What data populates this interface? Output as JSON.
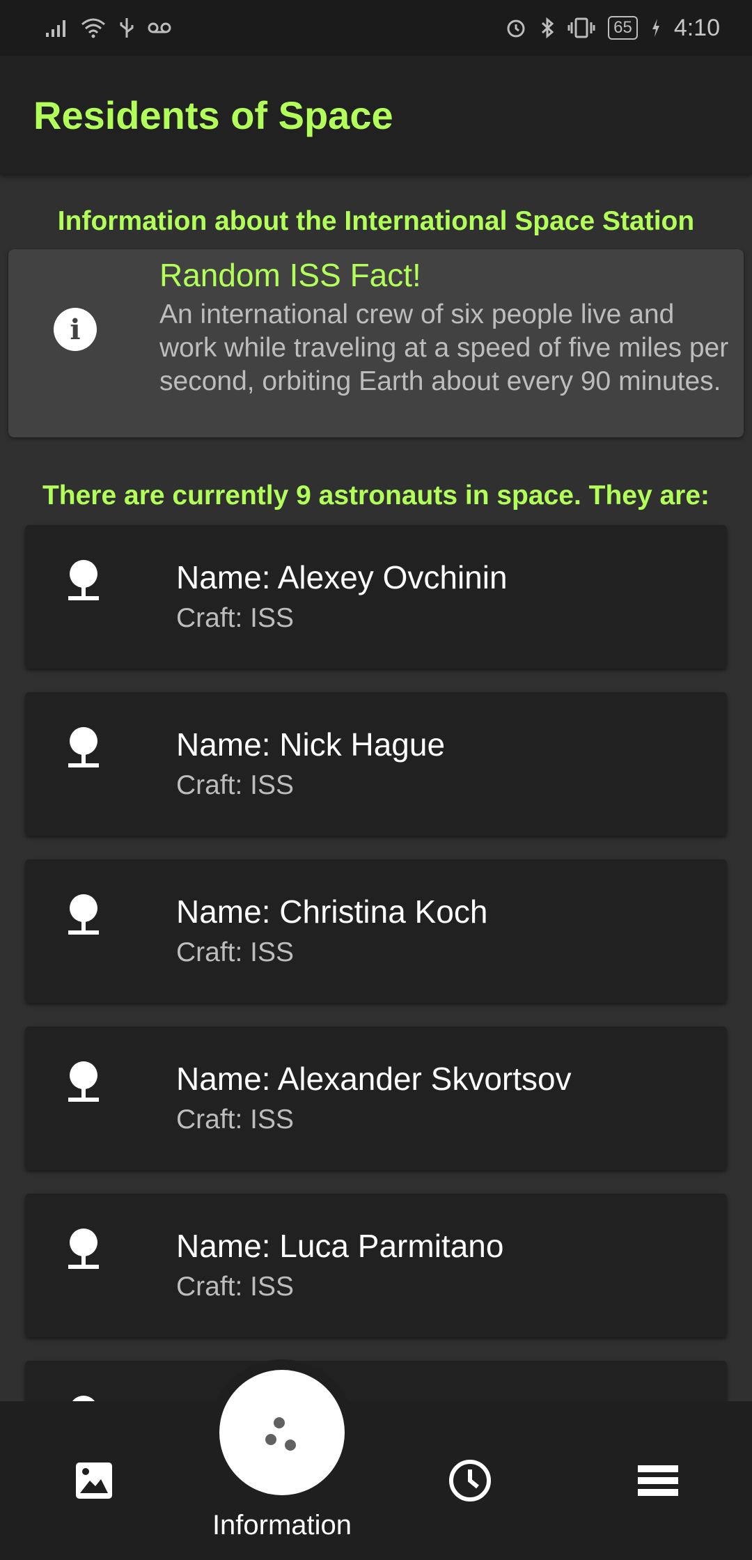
{
  "status_bar": {
    "left_icons": [
      "signal-icon",
      "wifi-icon",
      "usb-icon",
      "voicemail-icon"
    ],
    "right_icons": [
      "alarm-icon",
      "bluetooth-icon",
      "vibrate-icon",
      "battery-icon",
      "charging-icon"
    ],
    "battery": "65",
    "time": "4:10"
  },
  "app_bar": {
    "title": "Residents of Space"
  },
  "iss_section": {
    "heading": "Information about the International Space Station",
    "fact_title": "Random ISS Fact!",
    "fact_body": "An international crew of six people live and work while traveling at a speed of five miles per second, orbiting Earth about every 90 minutes.",
    "icon": "info-icon"
  },
  "crew_section": {
    "heading": "There are currently 9 astronauts in space. They are:",
    "astronauts": [
      {
        "name": "Name: Alexey Ovchinin",
        "craft": "Craft: ISS"
      },
      {
        "name": "Name: Nick Hague",
        "craft": "Craft: ISS"
      },
      {
        "name": "Name: Christina Koch",
        "craft": "Craft: ISS"
      },
      {
        "name": "Name: Alexander Skvortsov",
        "craft": "Craft: ISS"
      },
      {
        "name": "Name: Luca Parmitano",
        "craft": "Craft: ISS"
      }
    ],
    "icon": "person-icon"
  },
  "bottom_nav": {
    "items": [
      {
        "icon": "image-icon"
      },
      {
        "icon": "dots-icon",
        "label": "Information",
        "active": true
      },
      {
        "icon": "clock-icon"
      },
      {
        "icon": "menu-icon"
      }
    ]
  },
  "colors": {
    "accent": "#b2ff59",
    "background": "#303030",
    "card": "#212121",
    "fact_card": "#424242"
  }
}
